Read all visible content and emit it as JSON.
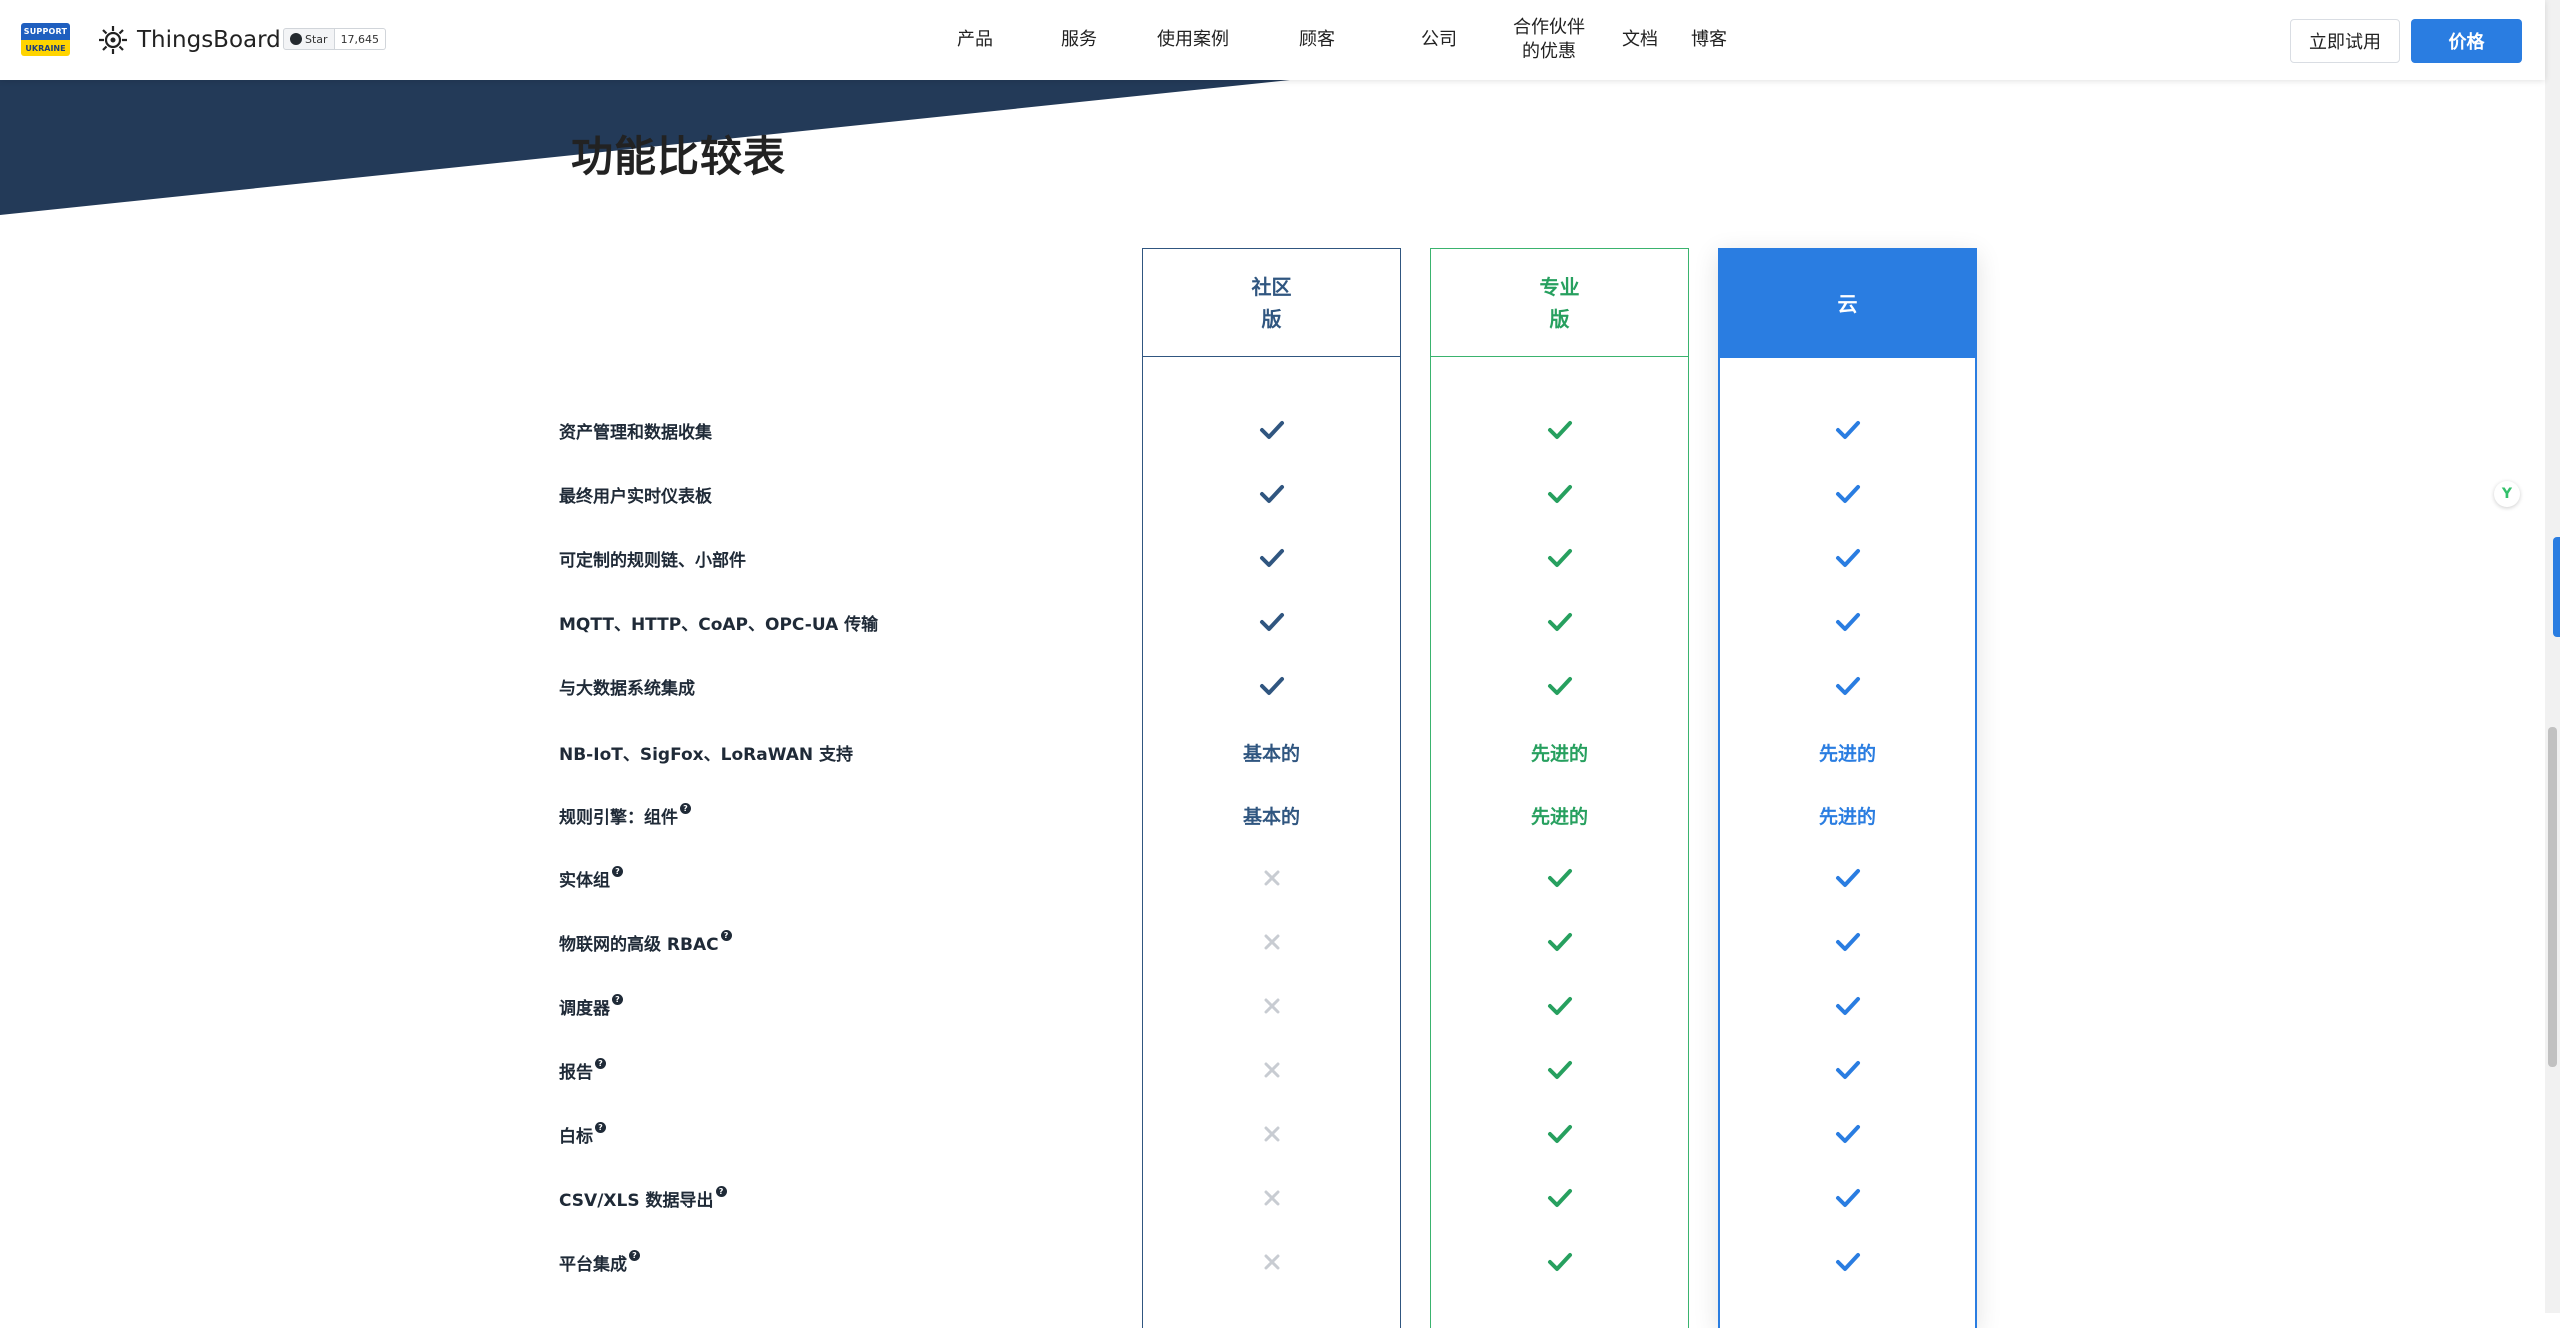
{
  "header": {
    "badge": {
      "line1": "SUPPORT",
      "line2": "UKRAINE"
    },
    "brand": "ThingsBoard",
    "github": {
      "label": "Star",
      "count": "17,645"
    },
    "nav": [
      {
        "label": "产品"
      },
      {
        "label": "服务"
      },
      {
        "label": "使用案例"
      },
      {
        "label": "顾客"
      },
      {
        "label": "公司"
      },
      {
        "label": "合作伙伴的优惠"
      },
      {
        "label": "文档"
      },
      {
        "label": "博客"
      }
    ],
    "trial_label": "立即试用",
    "price_label": "价格"
  },
  "section": {
    "title": "功能比较表"
  },
  "plans": [
    {
      "name": "社区版",
      "color": "#305680"
    },
    {
      "name": "专业版",
      "color": "#27a05f"
    },
    {
      "name": "云",
      "color": "#2a7de1"
    }
  ],
  "features": [
    {
      "label": "资产管理和数据收集",
      "help": false,
      "values": [
        "check",
        "check",
        "check"
      ]
    },
    {
      "label": "最终用户实时仪表板",
      "help": false,
      "values": [
        "check",
        "check",
        "check"
      ]
    },
    {
      "label": "可定制的规则链、小部件",
      "help": false,
      "values": [
        "check",
        "check",
        "check"
      ]
    },
    {
      "label": "MQTT、HTTP、CoAP、OPC-UA 传输",
      "help": false,
      "values": [
        "check",
        "check",
        "check"
      ]
    },
    {
      "label": "与大数据系统集成",
      "help": false,
      "values": [
        "check",
        "check",
        "check"
      ]
    },
    {
      "label": "NB-IoT、SigFox、LoRaWAN 支持",
      "help": false,
      "values": [
        "基本的",
        "先进的",
        "先进的"
      ]
    },
    {
      "label": "规则引擎：组件",
      "help": true,
      "values": [
        "基本的",
        "先进的",
        "先进的"
      ]
    },
    {
      "label": "实体组",
      "help": true,
      "values": [
        "cross",
        "check",
        "check"
      ]
    },
    {
      "label": "物联网的高级 RBAC",
      "help": true,
      "values": [
        "cross",
        "check",
        "check"
      ]
    },
    {
      "label": "调度器",
      "help": true,
      "values": [
        "cross",
        "check",
        "check"
      ]
    },
    {
      "label": "报告",
      "help": true,
      "values": [
        "cross",
        "check",
        "check"
      ]
    },
    {
      "label": "白标",
      "help": true,
      "values": [
        "cross",
        "check",
        "check"
      ]
    },
    {
      "label": "CSV/XLS 数据导出",
      "help": true,
      "values": [
        "cross",
        "check",
        "check"
      ]
    },
    {
      "label": "平台集成",
      "help": true,
      "values": [
        "cross",
        "check",
        "check"
      ]
    }
  ],
  "icons": {
    "check": "check-icon",
    "cross": "cross-icon",
    "help": "question-icon"
  }
}
